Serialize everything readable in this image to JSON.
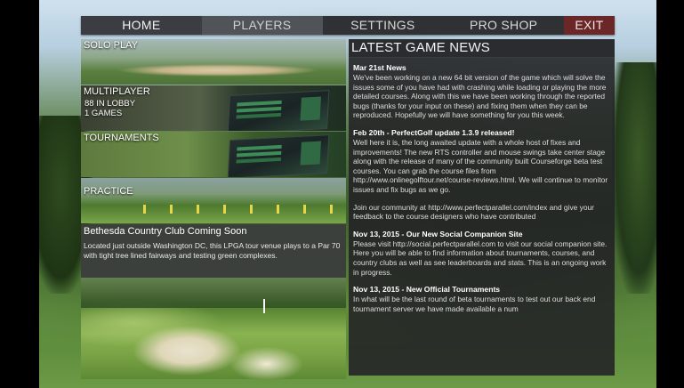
{
  "nav": {
    "home": "HOME",
    "players": "PLAYERS",
    "settings": "SETTINGS",
    "pro_shop": "PRO SHOP",
    "exit": "EXIT"
  },
  "modes": {
    "solo": {
      "title": "SOLO PLAY"
    },
    "multiplayer": {
      "title": "MULTIPLAYER",
      "lobby": "88 IN LOBBY",
      "games": "1 GAMES"
    },
    "tournaments": {
      "title": "TOURNAMENTS"
    },
    "practice": {
      "title": "PRACTICE"
    }
  },
  "feature": {
    "title": "Bethesda Country Club Coming Soon",
    "description": "Located just outside Washington DC, this LPGA tour venue plays to a Par 70 with tight tree lined fairways and testing green complexes."
  },
  "news": {
    "heading": "LATEST GAME NEWS",
    "items": [
      {
        "title": "Mar 21st News",
        "body": "We've been working on a new 64 bit version of the game which will solve the issues some of you have had with crashing while loading or playing the more detailed courses. Along with this we have been working through the reported bugs (thanks for your input on these) and fixing them when they can be reproduced. Hopefully we will have something for you this week."
      },
      {
        "title": "Feb 20th - PerfectGolf update 1.3.9 released!",
        "body": "Well here it is, the long awaited update with a whole host of fixes and improvements! The new RTS controller and mouse swings take center stage along with the release of many of the community built Courseforge beta test courses. You can grab the course files from\nhttp://www.onlinegolftour.net/course-reviews.html. We will continue to monitor issues and fix bugs as we go."
      },
      {
        "title": "",
        "body": "Join our community at http://www.perfectparallel.com/index and give your feedback to the course designers who have contributed"
      },
      {
        "title": "Nov 13, 2015 - Our New Social Companion Site",
        "body": "Please visit http://social.perfectparallel.com to visit our social companion site.  Here you will be able to find information about tournaments, courses, and country clubs as well as see leaderboards and stats.  This is an ongoing work in progress."
      },
      {
        "title": "Nov 13, 2015 - New Official Tournaments",
        "body": "In what will be the last round of beta tournaments to test out our back end tournament server we have made available a num"
      }
    ]
  }
}
